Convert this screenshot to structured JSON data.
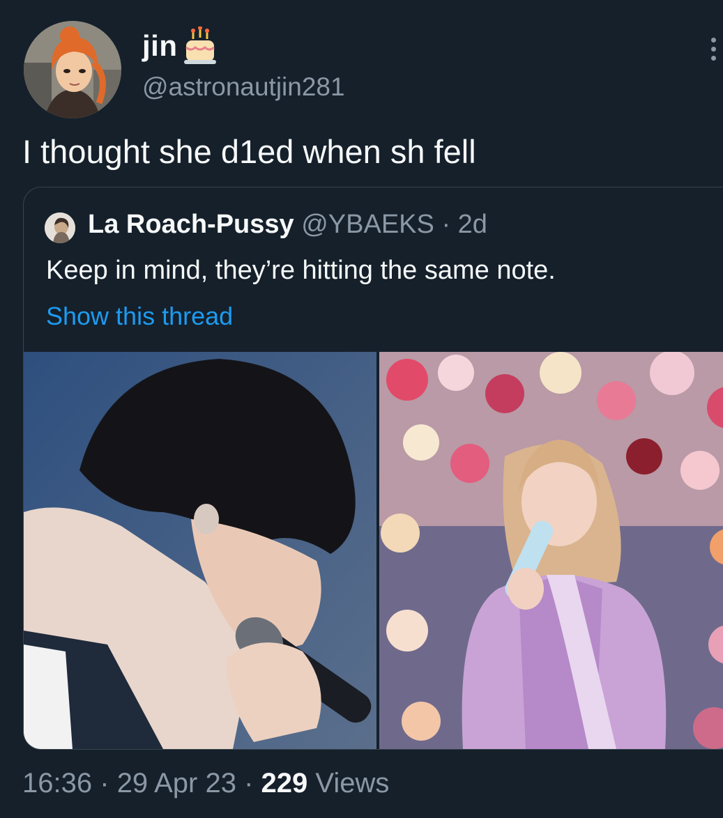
{
  "tweet": {
    "display_name": "jin",
    "handle": "@astronautjin281",
    "text": "I thought she d1ed when sh fell"
  },
  "quoted_tweet": {
    "display_name": "La Roach-Pussy",
    "handle": "@YBAEKS",
    "separator": "·",
    "time": "2d",
    "text": "Keep in mind, they’re hitting the same note.",
    "thread_link": "Show this thread"
  },
  "footer": {
    "time": "16:36",
    "sep1": "·",
    "date": "29 Apr 23",
    "sep2": "·",
    "views_count": "229",
    "views_label": "Views"
  },
  "icons": {
    "badge": "birthday-cake-icon",
    "menu": "more-options-icon"
  },
  "colors": {
    "background": "#15202b",
    "secondary_text": "#8b98a5",
    "link": "#1d9bf0",
    "border": "#38444d"
  }
}
